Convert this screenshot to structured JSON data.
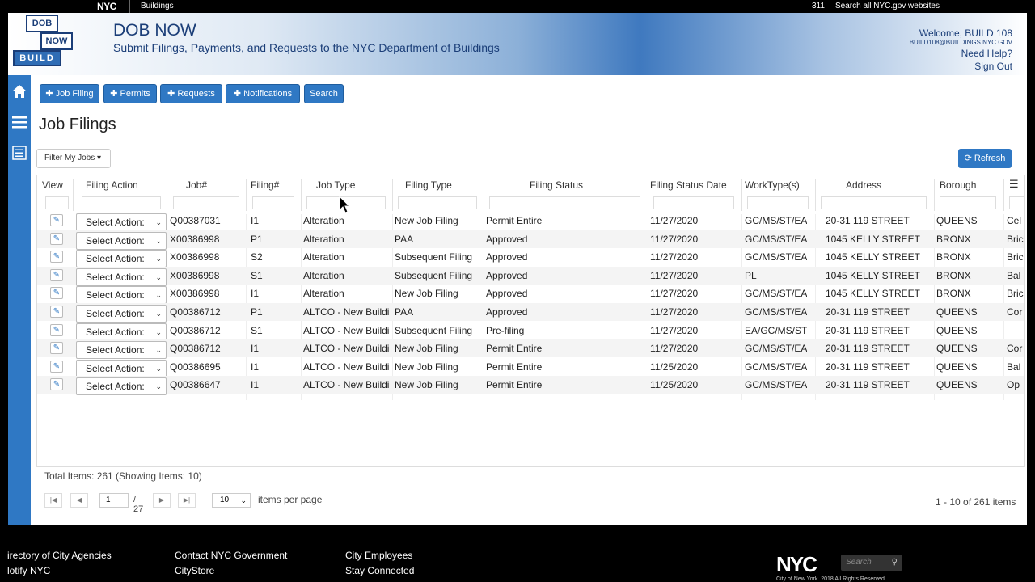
{
  "topbar": {
    "nyc_logo": "NYC",
    "agency": "Buildings",
    "n311": "311",
    "search_all": "Search all NYC.gov websites"
  },
  "logo": {
    "line1": "DOB",
    "line2": "NOW",
    "line3": "BUILD"
  },
  "header": {
    "title": "DOB NOW",
    "subtitle": "Submit Filings, Payments, and Requests to the NYC Department of Buildings",
    "welcome": "Welcome, BUILD 108",
    "email": "BUILD108@BUILDINGS.NYC.GOV",
    "help": "Need Help?",
    "signout": "Sign Out"
  },
  "toolbar": {
    "job_filing": "Job Filing",
    "permits": "Permits",
    "requests": "Requests",
    "notifications": "Notifications",
    "search": "Search"
  },
  "page_title": "Job Filings",
  "filter_label": "Filter My Jobs",
  "refresh_label": "Refresh",
  "columns": [
    "View",
    "Filing Action",
    "Job#",
    "Filing#",
    "Job Type",
    "Filing Type",
    "Filing Status",
    "Filing Status Date",
    "WorkType(s)",
    "Address",
    "Borough"
  ],
  "select_label": "Select Action:",
  "rows": [
    {
      "job": "Q00387031",
      "filing": "I1",
      "job_type": "Alteration",
      "filing_type": "New Job Filing",
      "status": "Permit Entire",
      "date": "11/27/2020",
      "work": "GC/MS/ST/EA",
      "address": "20-31 119 STREET",
      "borough": "QUEENS",
      "extra": "Cel"
    },
    {
      "job": "X00386998",
      "filing": "P1",
      "job_type": "Alteration",
      "filing_type": "PAA",
      "status": "Approved",
      "date": "11/27/2020",
      "work": "GC/MS/ST/EA",
      "address": "1045 KELLY STREET",
      "borough": "BRONX",
      "extra": "Bric"
    },
    {
      "job": "X00386998",
      "filing": "S2",
      "job_type": "Alteration",
      "filing_type": "Subsequent Filing",
      "status": "Approved",
      "date": "11/27/2020",
      "work": "GC/MS/ST/EA",
      "address": "1045 KELLY STREET",
      "borough": "BRONX",
      "extra": "Bric"
    },
    {
      "job": "X00386998",
      "filing": "S1",
      "job_type": "Alteration",
      "filing_type": "Subsequent Filing",
      "status": "Approved",
      "date": "11/27/2020",
      "work": "PL",
      "address": "1045 KELLY STREET",
      "borough": "BRONX",
      "extra": "Bal"
    },
    {
      "job": "X00386998",
      "filing": "I1",
      "job_type": "Alteration",
      "filing_type": "New Job Filing",
      "status": "Approved",
      "date": "11/27/2020",
      "work": "GC/MS/ST/EA",
      "address": "1045 KELLY STREET",
      "borough": "BRONX",
      "extra": "Bric"
    },
    {
      "job": "Q00386712",
      "filing": "P1",
      "job_type": "ALTCO - New Buildi",
      "filing_type": "PAA",
      "status": "Approved",
      "date": "11/27/2020",
      "work": "GC/MS/ST/EA",
      "address": "20-31 119 STREET",
      "borough": "QUEENS",
      "extra": "Cor"
    },
    {
      "job": "Q00386712",
      "filing": "S1",
      "job_type": "ALTCO - New Buildi",
      "filing_type": "Subsequent Filing",
      "status": "Pre-filing",
      "date": "11/27/2020",
      "work": "EA/GC/MS/ST",
      "address": "20-31 119 STREET",
      "borough": "QUEENS",
      "extra": ""
    },
    {
      "job": "Q00386712",
      "filing": "I1",
      "job_type": "ALTCO - New Buildi",
      "filing_type": "New Job Filing",
      "status": "Permit Entire",
      "date": "11/27/2020",
      "work": "GC/MS/ST/EA",
      "address": "20-31 119 STREET",
      "borough": "QUEENS",
      "extra": "Cor"
    },
    {
      "job": "Q00386695",
      "filing": "I1",
      "job_type": "ALTCO - New Buildi",
      "filing_type": "New Job Filing",
      "status": "Permit Entire",
      "date": "11/25/2020",
      "work": "GC/MS/ST/EA",
      "address": "20-31 119 STREET",
      "borough": "QUEENS",
      "extra": "Bal"
    },
    {
      "job": "Q00386647",
      "filing": "I1",
      "job_type": "ALTCO - New Buildi",
      "filing_type": "New Job Filing",
      "status": "Permit Entire",
      "date": "11/25/2020",
      "work": "GC/MS/ST/EA",
      "address": "20-31 119 STREET",
      "borough": "QUEENS",
      "extra": "Op"
    }
  ],
  "total_text": "Total Items: 261 (Showing Items: 10)",
  "pager": {
    "page": "1",
    "of_text": "/ 27",
    "per_page": "10",
    "per_page_label": "items per page",
    "range": "1 - 10 of 261 items"
  },
  "footer": {
    "col1": [
      "irectory of City Agencies",
      "lotify NYC"
    ],
    "col2": [
      "Contact NYC Government",
      "CityStore"
    ],
    "col3": [
      "City Employees",
      "Stay Connected"
    ],
    "logo": "NYC",
    "search_placeholder": "Search",
    "copyright": "City of New York. 2018 All Rights Reserved."
  }
}
